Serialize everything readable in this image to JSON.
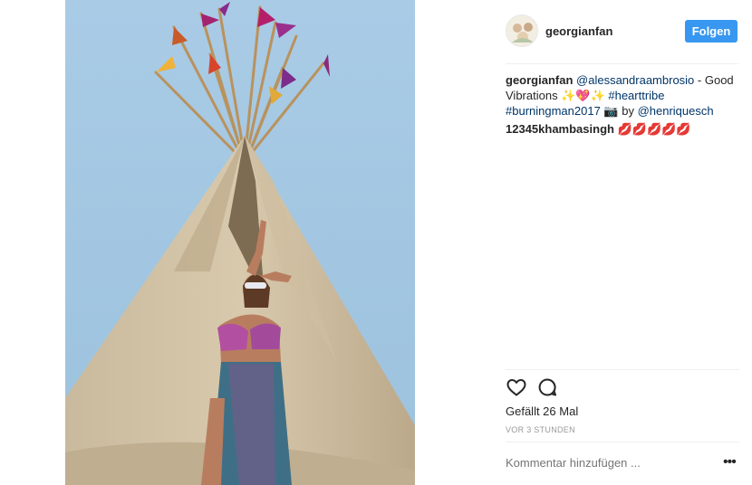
{
  "post": {
    "username": "georgianfan",
    "follow_label": "Folgen",
    "caption": {
      "user": "georgianfan",
      "mention": "@alessandraambrosio",
      "text1": " - Good Vibrations ✨💖✨ ",
      "hashtag1": "#hearttribe",
      "hashtag2": "#burningman2017",
      "text2": " 📷 by ",
      "mention2": "@henriquesch"
    },
    "comment": {
      "user": "12345khambasingh",
      "text": " 💋💋💋💋💋"
    },
    "likes": "Gefällt 26 Mal",
    "time": "VOR 3 STUNDEN",
    "comment_placeholder": "Kommentar hinzufügen ...",
    "more_label": "•••"
  },
  "icons": {
    "like": "heart-outline-icon",
    "comment": "speech-bubble-icon",
    "more": "ellipsis-icon"
  },
  "colors": {
    "follow_button": "#3897f0",
    "link": "#003569",
    "secondary_text": "#999999",
    "divider": "#efefef"
  }
}
